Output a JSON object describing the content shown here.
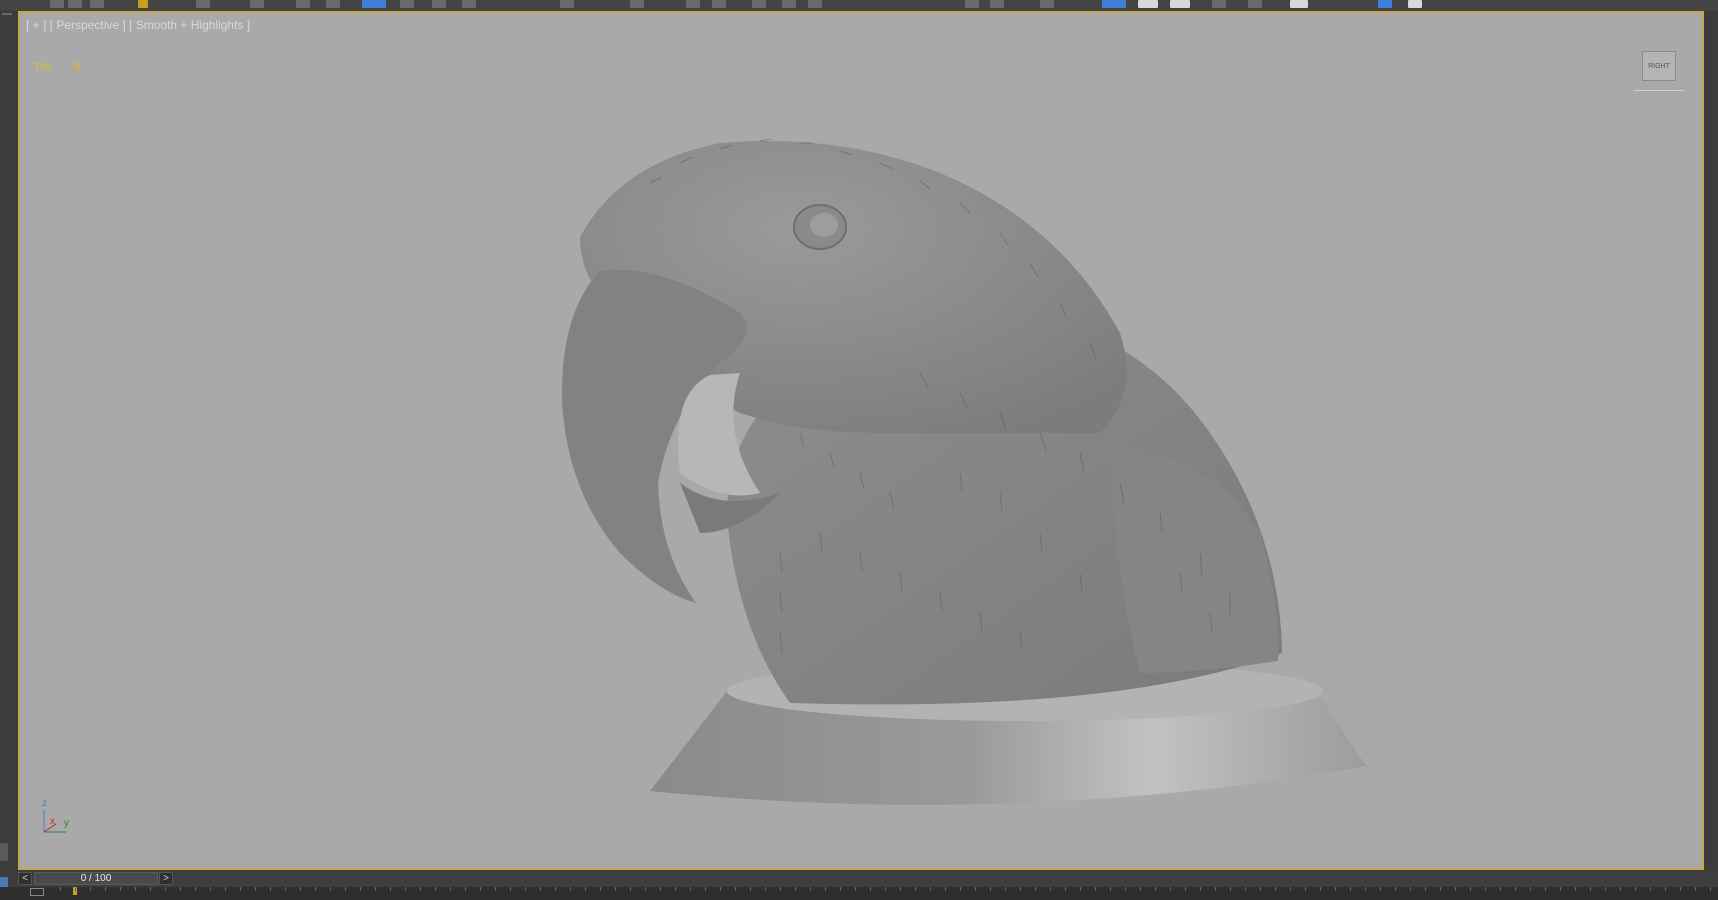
{
  "viewport": {
    "label": "[ + ] [ Perspective ] [ Smooth + Highlights ]",
    "stats": {
      "tris": "Tris",
      "tris_value": "0"
    },
    "viewcube_label": "RIGHT",
    "axis": {
      "z": "z",
      "x": "x",
      "y": "y"
    }
  },
  "timeline": {
    "prev": "<",
    "next": ">",
    "frame": "0 / 100"
  },
  "colors": {
    "viewport_bg": "#a9a9a9",
    "viewport_border": "#caa64a",
    "stats_text": "#e0c020",
    "active_tool": "#3d7fd9"
  }
}
